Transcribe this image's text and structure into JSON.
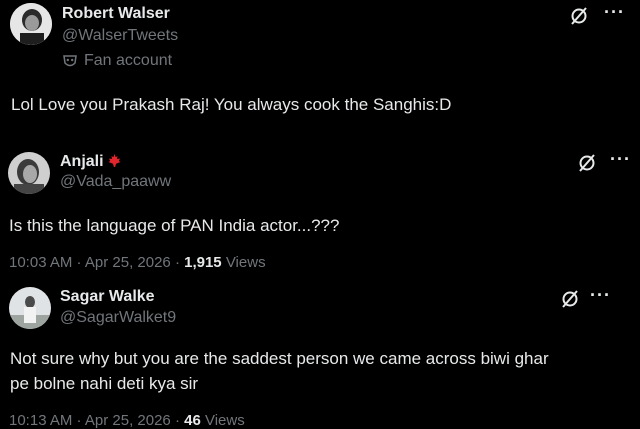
{
  "posts": [
    {
      "name": "Robert Walser",
      "handle": "@WalserTweets",
      "badge": "Fan account",
      "text": "Lol Love you Prakash Raj! You always cook the Sanghis:D"
    },
    {
      "name": "Anjali",
      "handle": "@Vada_paaww",
      "text": "Is this the language of PAN India actor...???",
      "time": "10:03 AM · Apr 25, 2026 · ",
      "views_count": "1,915",
      "views_label": " Views"
    },
    {
      "name": "Sagar Walke",
      "handle": "@SagarWalket9",
      "text_line1": "Not sure why but you are the saddest person we came across biwi ghar",
      "text_line2": "pe bolne nahi deti kya sir",
      "time": "10:13 AM · Apr 25, 2026 · ",
      "views_count": "46",
      "views_label": " Views"
    }
  ],
  "icons": {
    "more": "···",
    "grok": "grok-icon"
  },
  "colors": {
    "background": "#000000",
    "text": "#e7e9ea",
    "secondary": "#71767b",
    "flag": "#e0262c"
  }
}
